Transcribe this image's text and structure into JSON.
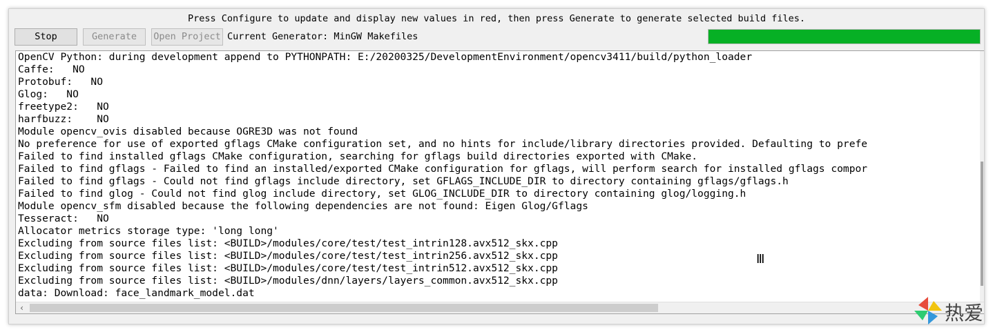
{
  "header": {
    "hint": "Press Configure to update and display new values in red, then press Generate to generate selected build files."
  },
  "toolbar": {
    "stop_label": "Stop",
    "generate_label": "Generate",
    "open_project_label": "Open Project",
    "generator_label": "Current Generator: MinGW Makefiles"
  },
  "progress": {
    "value": 1.0,
    "color": "#06b025"
  },
  "output": {
    "lines": [
      "OpenCV Python: during development append to PYTHONPATH: E:/20200325/DevelopmentEnvironment/opencv3411/build/python_loader",
      "Caffe:   NO",
      "Protobuf:   NO",
      "Glog:   NO",
      "freetype2:   NO",
      "harfbuzz:    NO",
      "Module opencv_ovis disabled because OGRE3D was not found",
      "No preference for use of exported gflags CMake configuration set, and no hints for include/library directories provided. Defaulting to prefe",
      "Failed to find installed gflags CMake configuration, searching for gflags build directories exported with CMake.",
      "Failed to find gflags - Failed to find an installed/exported CMake configuration for gflags, will perform search for installed gflags compor",
      "Failed to find gflags - Could not find gflags include directory, set GFLAGS_INCLUDE_DIR to directory containing gflags/gflags.h",
      "Failed to find glog - Could not find glog include directory, set GLOG_INCLUDE_DIR to directory containing glog/logging.h",
      "Module opencv_sfm disabled because the following dependencies are not found: Eigen Glog/Gflags",
      "Tesseract:   NO",
      "Allocator metrics storage type: 'long long'",
      "Excluding from source files list: <BUILD>/modules/core/test/test_intrin128.avx512_skx.cpp",
      "Excluding from source files list: <BUILD>/modules/core/test/test_intrin256.avx512_skx.cpp",
      "Excluding from source files list: <BUILD>/modules/core/test/test_intrin512.avx512_skx.cpp",
      "Excluding from source files list: <BUILD>/modules/dnn/layers/layers_common.avx512_skx.cpp",
      "data: Download: face_landmark_model.dat"
    ]
  },
  "icons": {
    "scroll_left": "chevron-left-icon",
    "cursor": "text-cursor-icon",
    "logo": "pinwheel-logo"
  },
  "watermark": {
    "text": "热爱"
  }
}
